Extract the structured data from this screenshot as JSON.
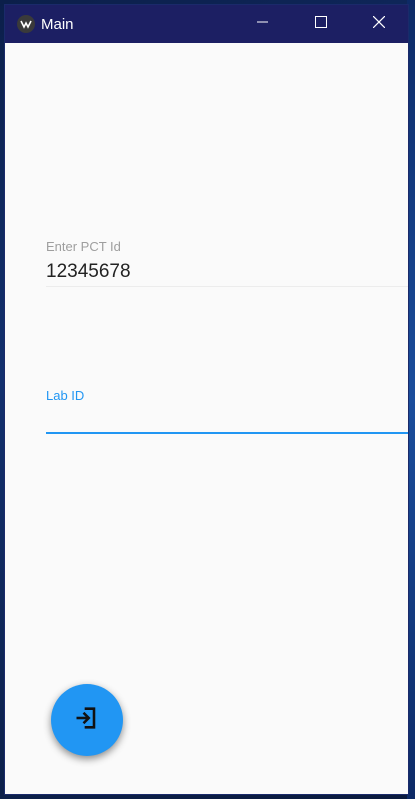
{
  "window": {
    "title": "Main",
    "app_icon": "kivy-logo-icon",
    "controls": [
      "minimize-icon",
      "maximize-icon",
      "close-icon"
    ]
  },
  "form": {
    "pct_field": {
      "label": "Enter PCT Id",
      "value": "12345678"
    },
    "lab_field": {
      "label": "Lab ID",
      "value": "",
      "focused": true
    }
  },
  "fab": {
    "icon": "login-icon"
  },
  "colors": {
    "titlebar": "#1c1f63",
    "accent": "#2196f3",
    "background": "#fafafa"
  }
}
